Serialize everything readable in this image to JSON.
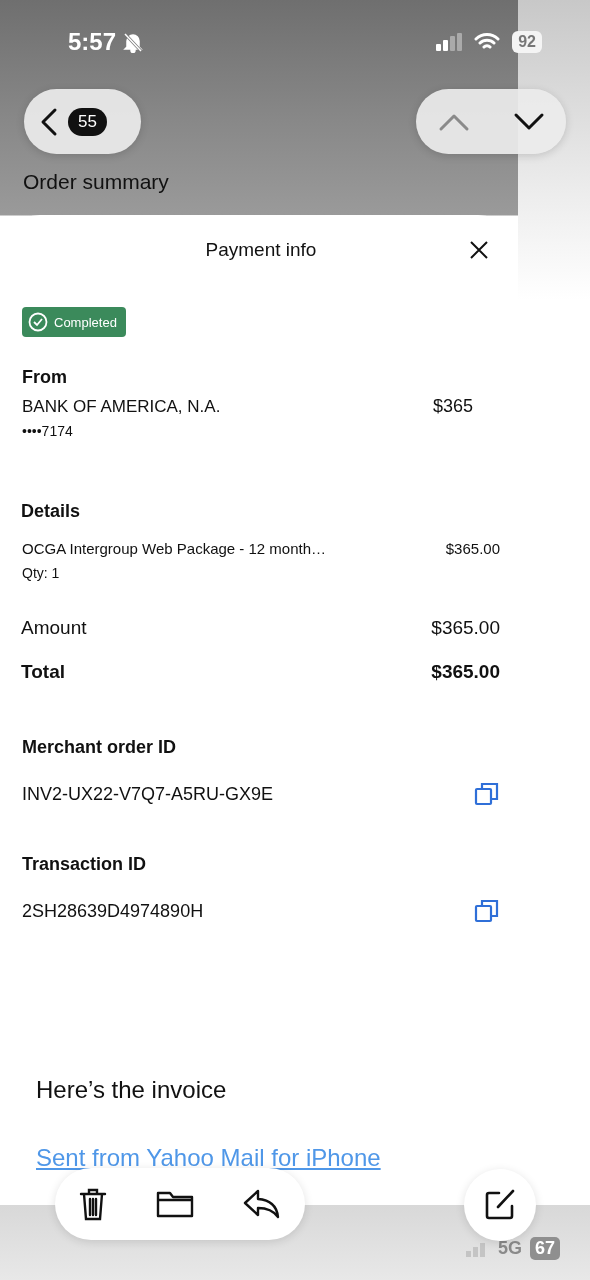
{
  "status_bar": {
    "time": "5:57",
    "battery": "92"
  },
  "nav": {
    "unread_count": "55",
    "previous_disabled": true,
    "next_disabled": false
  },
  "screenshot": {
    "heading": "Order summary",
    "sheet": {
      "title": "Payment info",
      "status": "Completed",
      "from": {
        "label": "From",
        "name": "BANK OF AMERICA, N.A.",
        "amount": "$365",
        "card": "••••7174"
      },
      "details": {
        "label": "Details",
        "items": [
          {
            "description": "OCGA Intergroup Web Package - 12 month…",
            "price": "$365.00",
            "qty": "Qty: 1"
          }
        ]
      },
      "totals": [
        {
          "kind": "amount",
          "label": "Amount",
          "value": "$365.00"
        },
        {
          "kind": "total",
          "label": "Total",
          "value": "$365.00"
        }
      ],
      "ids": [
        {
          "label": "Merchant order ID",
          "value": "INV2-UX22-V7Q7-A5RU-GX9E"
        },
        {
          "label": "Transaction ID",
          "value": "2SH28639D4974890H"
        }
      ]
    }
  },
  "email": {
    "body": "Here’s the invoice",
    "signature_link": "Sent from Yahoo Mail for iPhone"
  },
  "toolbar": [
    {
      "kind": "trash"
    },
    {
      "kind": "folder"
    },
    {
      "kind": "reply"
    }
  ],
  "background_status": {
    "network": "5G",
    "battery": "67"
  }
}
